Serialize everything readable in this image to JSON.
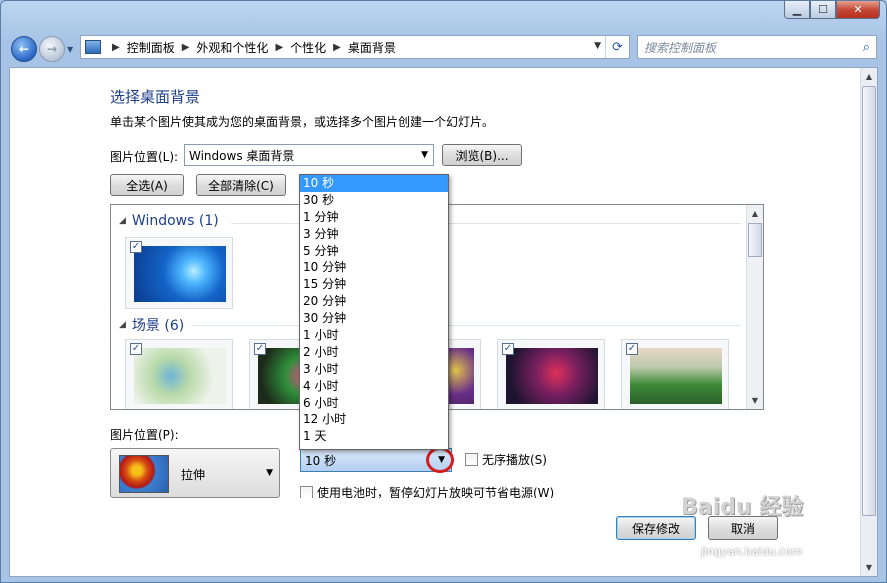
{
  "window": {
    "caption": {
      "min_label": "▁",
      "max_label": "☐",
      "close_label": "✕"
    }
  },
  "nav": {
    "back_icon": "←",
    "forward_icon": "→",
    "breadcrumb": [
      "控制面板",
      "外观和个性化",
      "个性化",
      "桌面背景"
    ],
    "refresh_icon": "⟳",
    "search_placeholder": "搜索控制面板",
    "search_icon": "⌕"
  },
  "page": {
    "title": "选择桌面背景",
    "subtitle": "单击某个图片使其成为您的桌面背景，或选择多个图片创建一个幻灯片。",
    "location_label": "图片位置(L):",
    "location_value": "Windows 桌面背景",
    "browse_label": "浏览(B)...",
    "select_all_label": "全选(A)",
    "clear_all_label": "全部清除(C)"
  },
  "groups": [
    {
      "title": "Windows (1)",
      "icon": "chevron-down-icon"
    },
    {
      "title": "场景 (6)",
      "icon": "chevron-down-icon"
    }
  ],
  "thumbnails": {
    "windows": [
      {
        "checked": true
      }
    ],
    "scenes": [
      {
        "checked": true
      },
      {
        "checked": true
      },
      {
        "checked": true
      },
      {
        "checked": true
      },
      {
        "checked": true
      }
    ]
  },
  "bottom": {
    "position_label": "图片位置(P):",
    "position_value": "拉伸",
    "interval_value": "10 秒",
    "shuffle_label": "无序播放(S)",
    "battery_label": "使用电池时，暂停幻灯片放映可节省电源(W)"
  },
  "dropdown": {
    "selected": "10 秒",
    "items": [
      "10 秒",
      "30 秒",
      "1 分钟",
      "3 分钟",
      "5 分钟",
      "10 分钟",
      "15 分钟",
      "20 分钟",
      "30 分钟",
      "1 小时",
      "2 小时",
      "3 小时",
      "4 小时",
      "6 小时",
      "12 小时",
      "1 天"
    ]
  },
  "footer": {
    "save_label": "保存修改",
    "cancel_label": "取消"
  },
  "watermark": {
    "brand": "Baidu 经验",
    "url": "jingyan.baidu.com"
  },
  "colors": {
    "accent": "#1e3f8a",
    "selection": "#3399ff",
    "highlight_ring": "#d61c1c"
  }
}
